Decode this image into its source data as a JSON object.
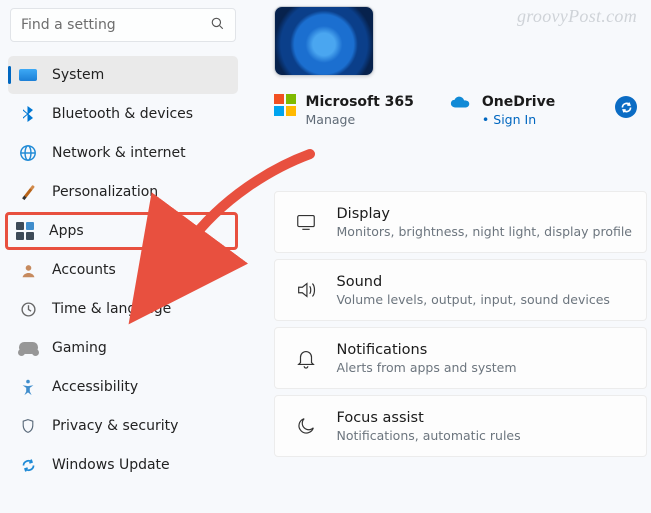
{
  "watermark": "groovyPost.com",
  "search": {
    "placeholder": "Find a setting"
  },
  "sidebar": {
    "items": [
      {
        "label": "System"
      },
      {
        "label": "Bluetooth & devices"
      },
      {
        "label": "Network & internet"
      },
      {
        "label": "Personalization"
      },
      {
        "label": "Apps"
      },
      {
        "label": "Accounts"
      },
      {
        "label": "Time & language"
      },
      {
        "label": "Gaming"
      },
      {
        "label": "Accessibility"
      },
      {
        "label": "Privacy & security"
      },
      {
        "label": "Windows Update"
      }
    ]
  },
  "header": {
    "ms365": {
      "title": "Microsoft 365",
      "action": "Manage"
    },
    "onedrive": {
      "title": "OneDrive",
      "action": "Sign In"
    }
  },
  "tiles": [
    {
      "label": "Display",
      "sub": "Monitors, brightness, night light, display profile"
    },
    {
      "label": "Sound",
      "sub": "Volume levels, output, input, sound devices"
    },
    {
      "label": "Notifications",
      "sub": "Alerts from apps and system"
    },
    {
      "label": "Focus assist",
      "sub": "Notifications, automatic rules"
    }
  ]
}
